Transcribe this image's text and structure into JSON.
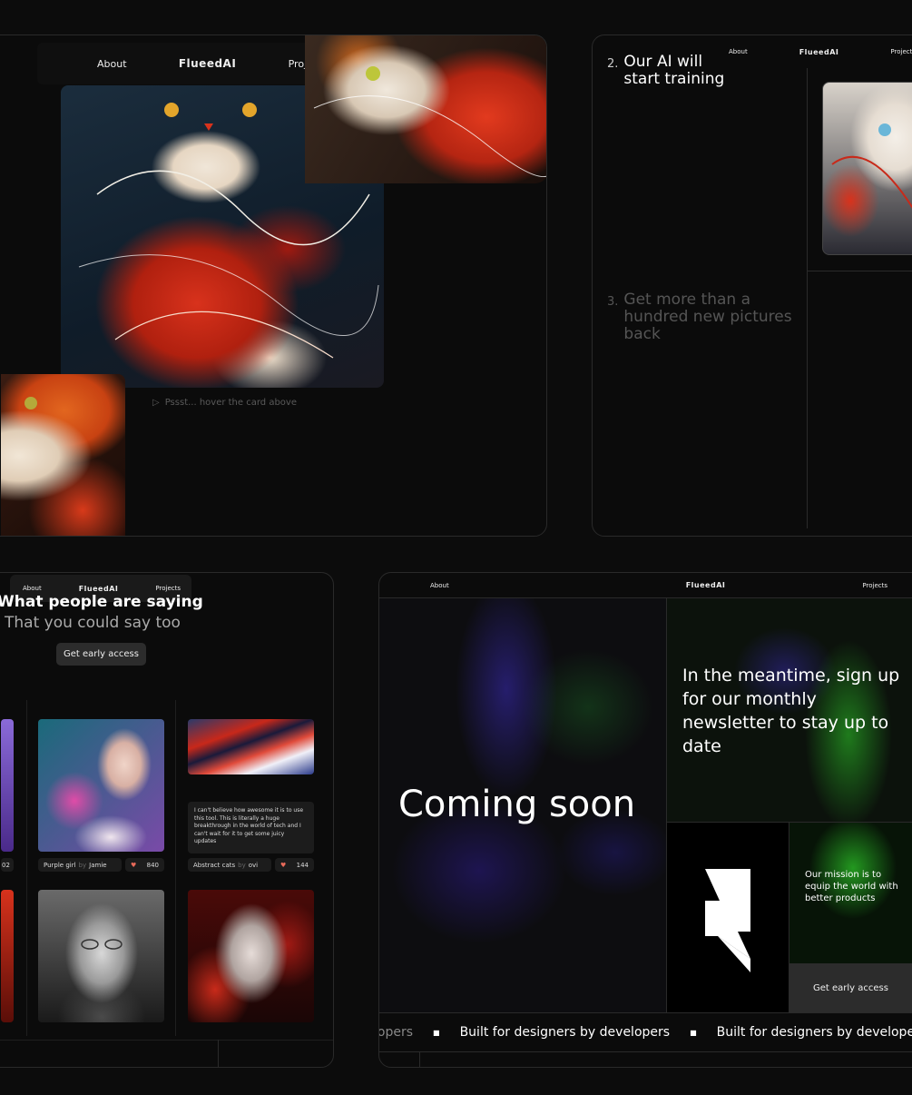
{
  "panel_tl": {
    "nav": {
      "about": "About",
      "brand": "FlueedAI",
      "projects": "Projects"
    },
    "hint": "Pssst... hover the card above"
  },
  "panel_tr": {
    "nav": {
      "about": "About",
      "brand": "FlueedAI",
      "projects": "Projects"
    },
    "step2_num": "2.",
    "step2_text": "Our AI will start training",
    "step3_num": "3.",
    "step3_text": "Get more than a hundred new pictures back"
  },
  "panel_bl": {
    "nav": {
      "about": "About",
      "brand": "FlueedAI",
      "projects": "Projects"
    },
    "title": "What people are saying",
    "subtitle": "That you could say too",
    "cta": "Get early access",
    "left_count": "02",
    "cards": [
      {
        "title": "Purple girl",
        "by": "by",
        "author": "Jamie",
        "likes": "840"
      },
      {
        "title": "Abstract cats",
        "by": "by",
        "author": "ovi",
        "likes": "144"
      }
    ],
    "quote": "I can't believe how awesome it is to use this tool. This is literally a huge breakthrough in the world of tech and I can't wait for it to get some juicy updates"
  },
  "panel_br": {
    "nav": {
      "about": "About",
      "brand": "FlueedAI",
      "projects": "Projects"
    },
    "headline": "Coming soon",
    "newsletter": "In the meantime, sign up for our monthly newsletter to stay up to date",
    "mission": "Our mission is to equip the world with better products",
    "cta": "Get early access",
    "ticker": [
      "lopers",
      "Built for designers by developers",
      "Built for designers by developers"
    ]
  },
  "colors": {
    "background": "#0c0c0c",
    "accent_red": "#d8321c",
    "accent_green": "#2fd12a",
    "accent_purple": "#3a2bb8"
  }
}
